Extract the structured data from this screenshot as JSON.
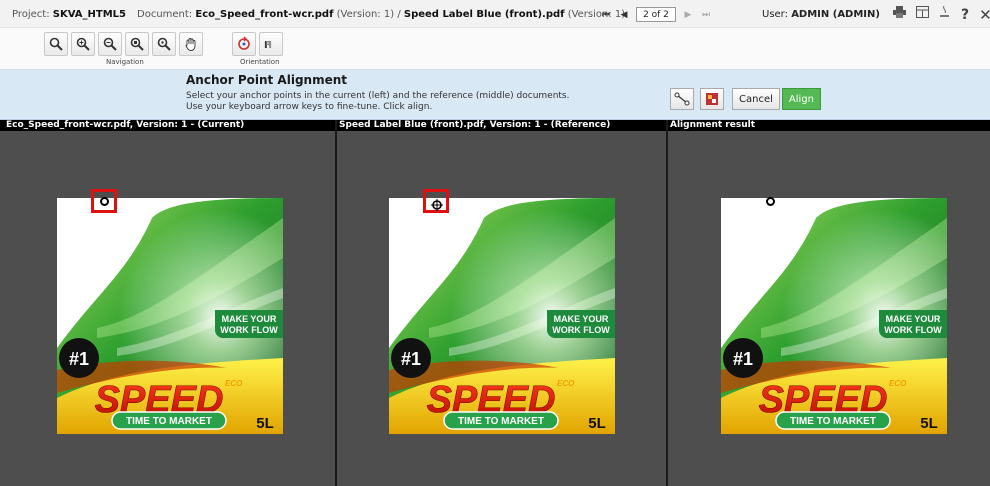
{
  "header": {
    "project_label": "Project:",
    "project_name": "SKVA_HTML5",
    "document_label": "Document:",
    "current_doc": "Eco_Speed_front-wcr.pdf",
    "current_version": "(Version: 1)",
    "doc_separator": "/",
    "reference_doc": "Speed Label Blue (front).pdf",
    "reference_version": "(Version: 1)",
    "page_indicator": "2 of 2",
    "user_label": "User:",
    "user_name": "ADMIN (ADMIN)"
  },
  "toolbar": {
    "navigation_label": "Navigation",
    "orientation_label": "Orientation",
    "navigation_tools": [
      "zoom-fit-icon",
      "zoom-in-icon",
      "zoom-out-icon",
      "zoom-page-icon",
      "zoom-actual-icon",
      "pan-hand-icon"
    ],
    "orientation_tools": [
      "rotate-icon",
      "flip-icon"
    ]
  },
  "alignment_panel": {
    "title": "Anchor Point Alignment",
    "line1": "Select your anchor points in the current (left) and the reference (middle) documents.",
    "line2": "Use your keyboard arrow keys to fine-tune. Click align.",
    "cancel_label": "Cancel",
    "align_label": "Align"
  },
  "views": [
    {
      "header": "Eco_Speed_front-wcr.pdf, Version: 1 - (Current)"
    },
    {
      "header": "Speed Label Blue (front).pdf, Version: 1 - (Reference)"
    },
    {
      "header": "Alignment result"
    }
  ],
  "label_art": {
    "badge": "#1",
    "tagline_line1": "MAKE YOUR",
    "tagline_line2": "WORK FLOW",
    "brand": "SPEED",
    "brand_sub": "ECO",
    "ribbon": "TIME TO MARKET",
    "volume": "5L"
  },
  "colors": {
    "accent_green": "#54b954",
    "panel_bg": "#d8e8f4",
    "view_bg": "#4e4e4e",
    "highlight_red": "#e01010"
  }
}
